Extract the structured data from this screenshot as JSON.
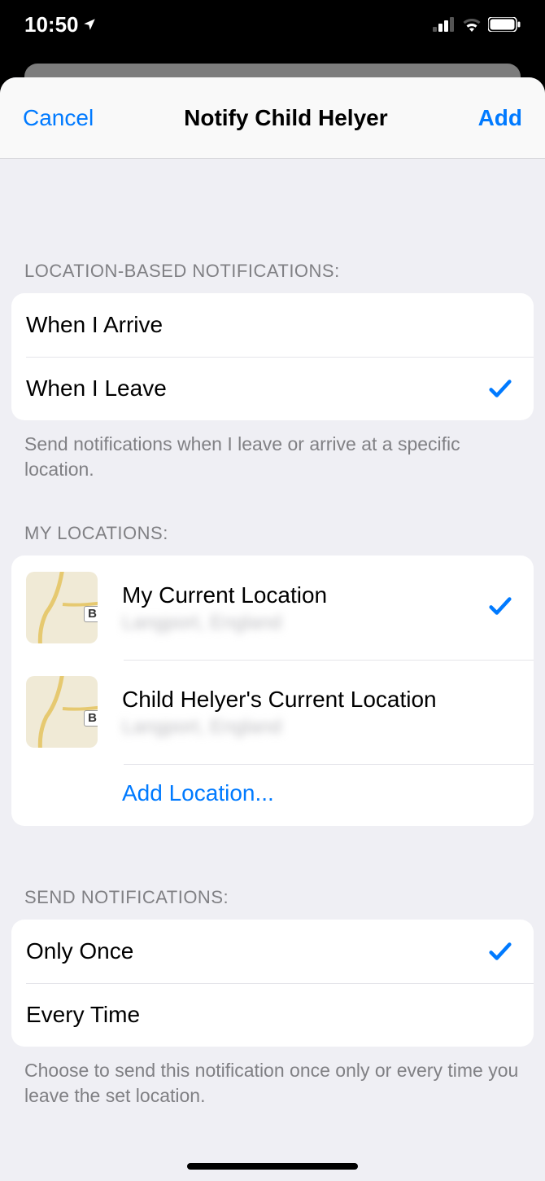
{
  "status": {
    "time": "10:50"
  },
  "nav": {
    "cancel": "Cancel",
    "title": "Notify Child Helyer",
    "add": "Add"
  },
  "section1": {
    "header": "LOCATION-BASED NOTIFICATIONS:",
    "options": [
      {
        "label": "When I Arrive",
        "selected": false
      },
      {
        "label": "When I Leave",
        "selected": true
      }
    ],
    "footer": "Send notifications when I leave or arrive at a specific location."
  },
  "section2": {
    "header": "MY LOCATIONS:",
    "locations": [
      {
        "title": "My Current Location",
        "subtitle": "Langport, England",
        "selected": true,
        "badge": "B"
      },
      {
        "title": "Child Helyer's Current Location",
        "subtitle": "Langport, England",
        "selected": false,
        "badge": "B"
      }
    ],
    "add": "Add Location..."
  },
  "section3": {
    "header": "SEND NOTIFICATIONS:",
    "options": [
      {
        "label": "Only Once",
        "selected": true
      },
      {
        "label": "Every Time",
        "selected": false
      }
    ],
    "footer": "Choose to send this notification once only or every time you leave the set location."
  }
}
